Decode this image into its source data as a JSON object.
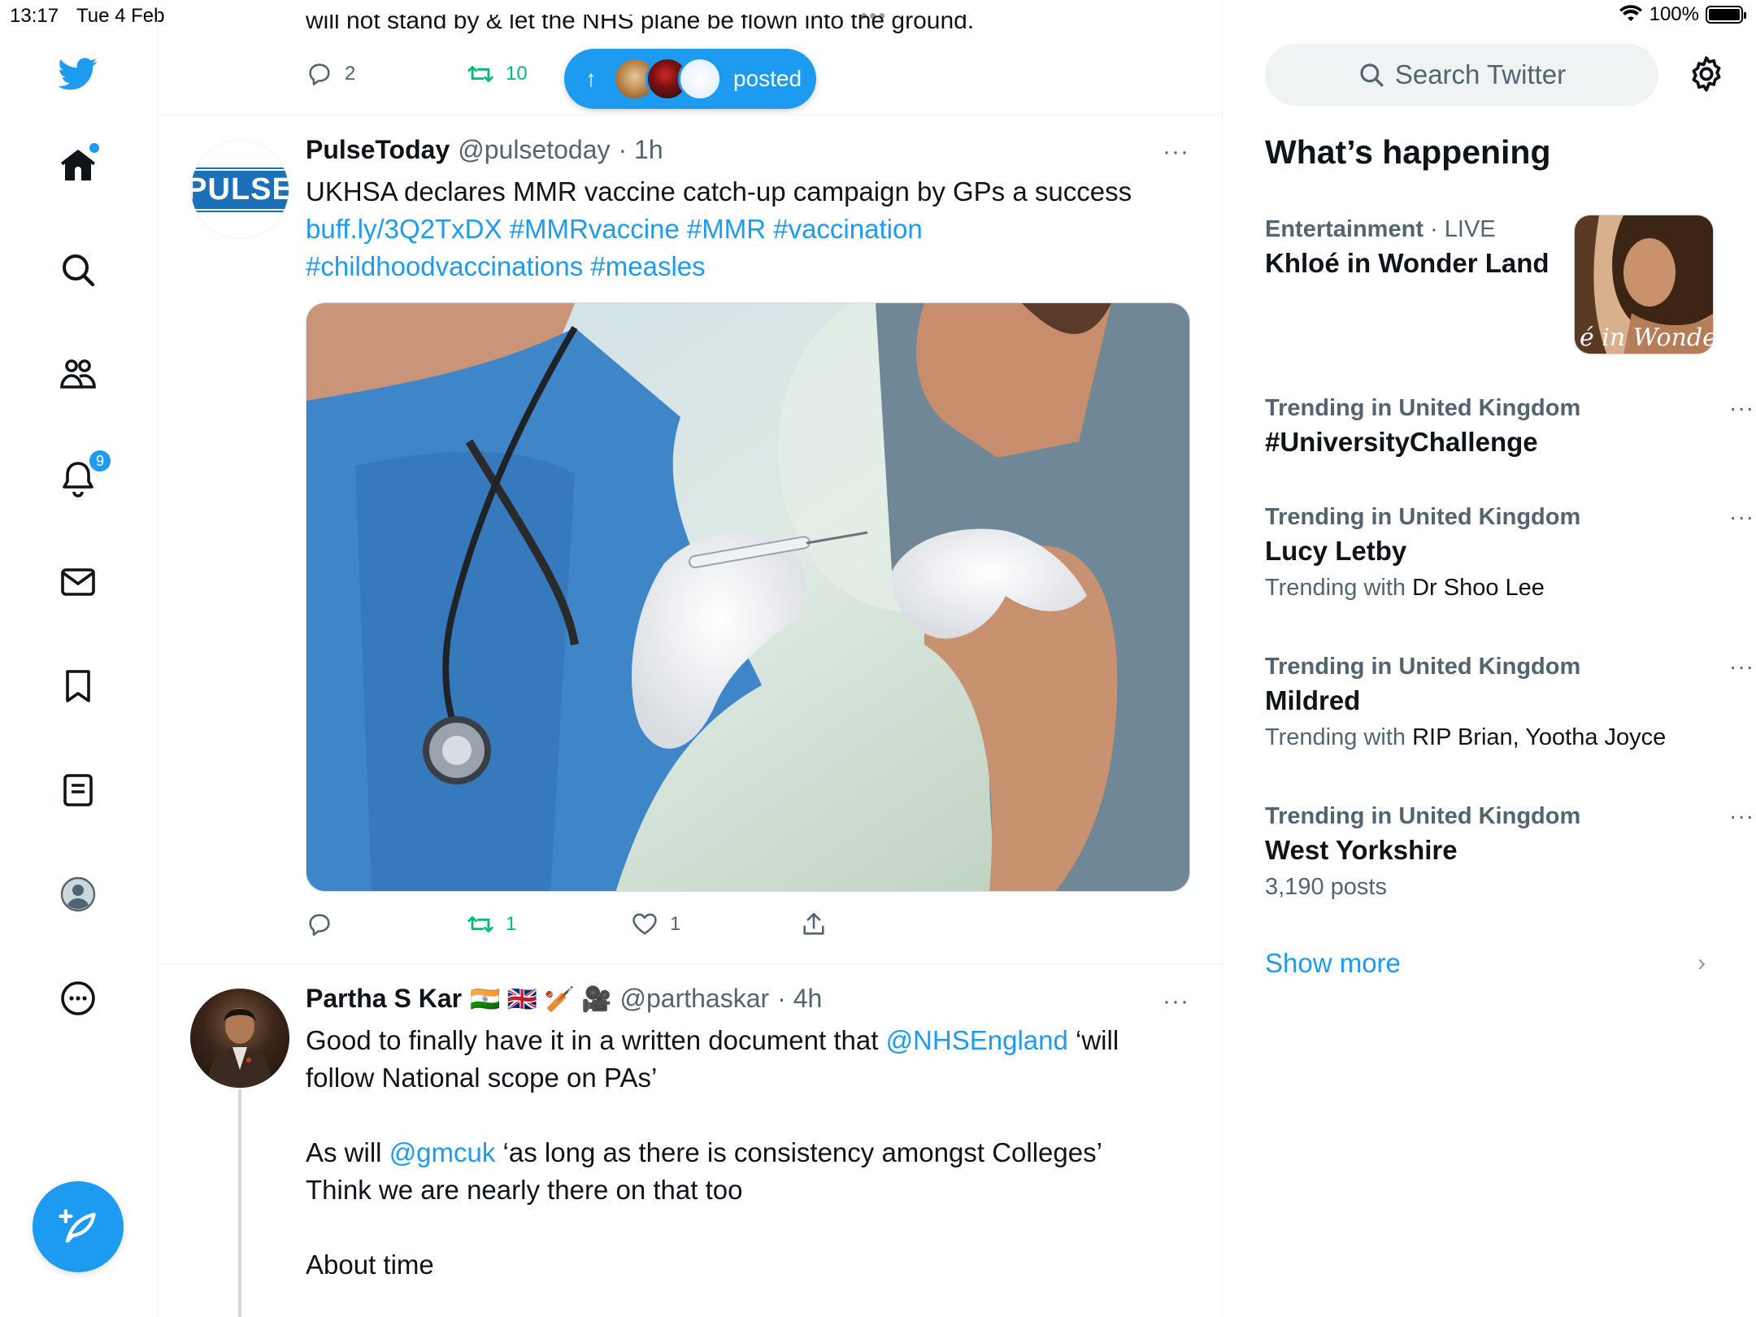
{
  "status_bar": {
    "time": "13:17",
    "date": "Tue 4 Feb",
    "battery": "100%",
    "multitask_dots": "•••"
  },
  "nav": {
    "items": [
      {
        "name": "twitter-logo-icon"
      },
      {
        "name": "home-icon",
        "has_new": true
      },
      {
        "name": "explore-icon"
      },
      {
        "name": "communities-icon"
      },
      {
        "name": "notifications-icon",
        "badge": "9"
      },
      {
        "name": "messages-icon"
      },
      {
        "name": "bookmarks-icon"
      },
      {
        "name": "lists-icon"
      },
      {
        "name": "profile-icon"
      },
      {
        "name": "more-icon"
      }
    ],
    "compose": "compose-tweet-icon"
  },
  "feed": {
    "top_tweet": {
      "text_cut": "will not stand by & let the NHS plane be flown into the ground.",
      "replies": "2",
      "retweets": "10"
    },
    "posted_pill": {
      "label": "posted",
      "arrow": "↑"
    },
    "tweets": [
      {
        "name": "PulseToday",
        "handle": "@pulsetoday",
        "time": "· 1h",
        "avatar_text": "PULSE",
        "text": "UKHSA declares MMR vaccine catch-up campaign by GPs a success",
        "link": "buff.ly/3Q2TxDX",
        "hashtags_line1": "#MMRvaccine #MMR #vaccination",
        "hashtags_line2": "#childhoodvaccinations #measles",
        "replies": "",
        "retweets": "1",
        "likes": "1",
        "more": "···"
      },
      {
        "name": "Partha S Kar",
        "flags": "🇮🇳 🇬🇧 🏏 🎥",
        "handle": "@parthaskar",
        "time": "· 4h",
        "line1_pre": "Good to finally have it in a written document that ",
        "mention1": "@NHSEngland",
        "line1_post": " ‘will",
        "line2": "follow National scope on PAs’",
        "line3_pre": "As will ",
        "mention2": "@gmcuk",
        "line3_post": " ‘as long as there is consistency amongst Colleges’",
        "line4": "Think we are nearly there on that too",
        "line5": "About time",
        "more": "···"
      }
    ]
  },
  "sidebar": {
    "search_placeholder": "Search Twitter",
    "heading": "What’s happening",
    "trends": [
      {
        "category": "Entertainment",
        "live": "· LIVE",
        "title": "Khloé in Wonder Land",
        "image_text": "é in Wonder L"
      },
      {
        "category": "Trending in United Kingdom",
        "title": "#UniversityChallenge",
        "more": "···"
      },
      {
        "category": "Trending in United Kingdom",
        "title": "Lucy Letby",
        "sub_prefix": "Trending with ",
        "sub_value": "Dr Shoo Lee",
        "more": "···"
      },
      {
        "category": "Trending in United Kingdom",
        "title": "Mildred",
        "sub_prefix": "Trending with ",
        "sub_value": "RIP Brian, Yootha Joyce",
        "more": "···"
      },
      {
        "category": "Trending in United Kingdom",
        "title": "West Yorkshire",
        "posts": "3,190 posts",
        "more": "···"
      }
    ],
    "show_more": "Show more",
    "show_more_chevron": "›"
  },
  "colors": {
    "accent": "#1d9bf0",
    "retweet": "#00ba7c",
    "secondary_text": "#536471"
  }
}
